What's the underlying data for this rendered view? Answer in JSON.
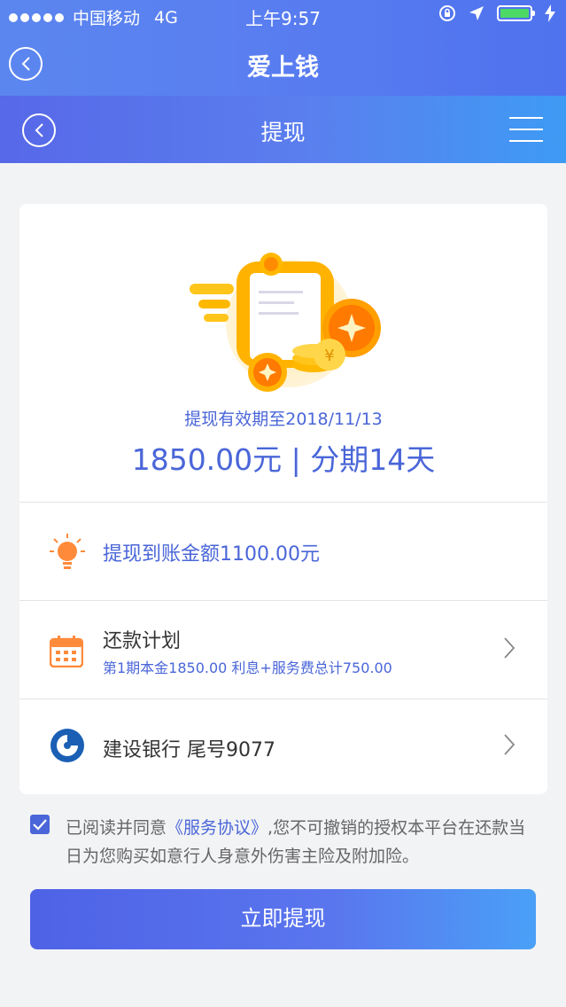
{
  "status_bar": {
    "carrier": "中国移动",
    "network": "4G",
    "time": "上午9:57"
  },
  "nav_primary": {
    "title": "爱上钱"
  },
  "nav_secondary": {
    "title": "提现"
  },
  "summary": {
    "validity": "提现有效期至2018/11/13",
    "amount": "1850.00元",
    "separator": " | ",
    "term": "分期14天"
  },
  "arrival_row": {
    "text": "提现到账金额1100.00元"
  },
  "repayment_row": {
    "title": "还款计划",
    "detail": "第1期本金1850.00 利息+服务费总计750.00"
  },
  "bank_row": {
    "text": "建设银行 尾号9077"
  },
  "agreement": {
    "checked": true,
    "prefix": "已阅读并同意",
    "link": "《服务协议》",
    "suffix": ",您不可撤销的授权本平台在还款当日为您购买如意行人身意外伤害主险及附加险。"
  },
  "submit_button": {
    "label": "立即提现"
  },
  "colors": {
    "accent": "#4a66d8",
    "checkbox": "#4a66d8",
    "battery": "#4cd964"
  },
  "icons": [
    "back-icon",
    "menu-icon",
    "bulb-icon",
    "calendar-icon",
    "ccb-bank-icon",
    "chevron-right-icon",
    "check-icon"
  ]
}
